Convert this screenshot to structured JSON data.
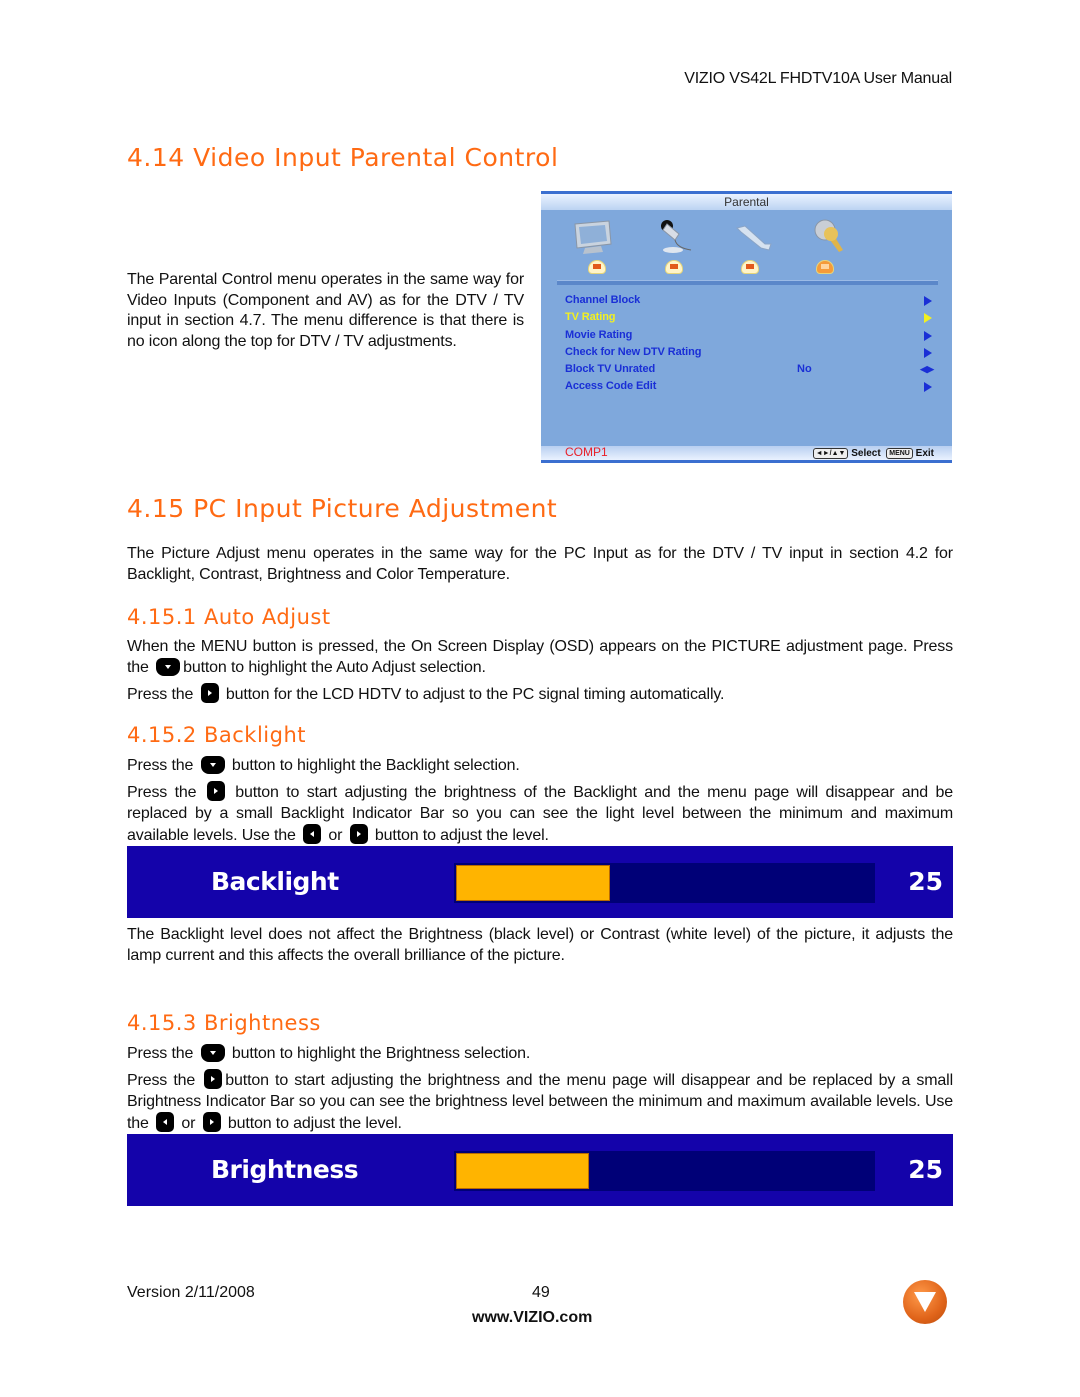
{
  "header": {
    "manual_title": "VIZIO VS42L FHDTV10A User Manual"
  },
  "section_4_14": {
    "heading": "4.14 Video Input Parental Control",
    "body": "The Parental Control menu operates in the same way for Video Inputs (Component and AV) as for the DTV / TV input in section 4.7.  The menu difference is that there is no icon along the top for DTV / TV adjustments.",
    "osd": {
      "title": "Parental",
      "icons": [
        "tv-screen-icon",
        "microphone-icon",
        "wrench-icon",
        "keys-icon"
      ],
      "active_tab_index": 3,
      "items": [
        {
          "label": "Channel Block",
          "value": "",
          "control": "arrow-right",
          "selected": false
        },
        {
          "label": "TV Rating",
          "value": "",
          "control": "arrow-right",
          "selected": true
        },
        {
          "label": "Movie Rating",
          "value": "",
          "control": "arrow-right",
          "selected": false
        },
        {
          "label": "Check for New DTV Rating",
          "value": "",
          "control": "arrow-right",
          "selected": false
        },
        {
          "label": "Block TV Unrated",
          "value": "No",
          "control": "arrow-left-right",
          "selected": false
        },
        {
          "label": "Access Code Edit",
          "value": "",
          "control": "arrow-right",
          "selected": false
        }
      ],
      "input_label": "COMP1",
      "nav_key": "◄►/▲▼",
      "select_label": "Select",
      "menu_key": "MENU",
      "exit_label": "Exit",
      "colors": {
        "item": "#1a2fd6",
        "selected": "#f2f020",
        "input": "#e8202a",
        "background": "#7fa8dc"
      }
    }
  },
  "section_4_15": {
    "heading": "4.15 PC Input Picture Adjustment",
    "body": "The Picture Adjust menu operates in the same way for the PC Input as for the DTV / TV input in section 4.2 for Backlight, Contrast, Brightness and Color Temperature.",
    "auto_adjust": {
      "heading": "4.15.1 Auto Adjust",
      "p1_a": "When the MENU button is pressed, the On Screen Display (OSD) appears on the PICTURE adjustment page.  Press the ",
      "p1_b": "button to highlight the Auto Adjust selection.",
      "p2_a": "Press the ",
      "p2_b": " button for the LCD HDTV to adjust to the PC signal timing automatically."
    },
    "backlight": {
      "heading": "4.15.2 Backlight",
      "p1_a": "Press the ",
      "p1_b": " button to highlight the Backlight selection.",
      "p2_a": "Press the ",
      "p2_b": " button to start adjusting the brightness of the Backlight and the menu page will disappear and be replaced by a small Backlight Indicator Bar so you can see the light level between the minimum and maximum available levels.  Use the ",
      "p2_c": " or ",
      "p2_d": " button to adjust the level.",
      "indicator": {
        "label": "Backlight",
        "value": "25",
        "fill_fraction": 0.37
      },
      "p3": "The Backlight level does not affect the Brightness (black level) or Contrast (white level) of the picture, it adjusts the lamp current and this affects the overall brilliance of the picture."
    },
    "brightness": {
      "heading": "4.15.3 Brightness",
      "p1_a": "Press the ",
      "p1_b": " button to highlight the Brightness selection.",
      "p2_a": "Press the ",
      "p2_b": "button to start adjusting the brightness and the menu page will disappear and be replaced by a small Brightness Indicator Bar so you can see the brightness level between the minimum and maximum available levels.  Use the ",
      "p2_c": " or ",
      "p2_d": " button to adjust the level.",
      "indicator": {
        "label": "Brightness",
        "value": "25",
        "fill_fraction": 0.32
      }
    }
  },
  "footer": {
    "version": "Version 2/11/2008",
    "page_number": "49",
    "url": "www.VIZIO.com",
    "logo": "vizio-v-logo-icon"
  },
  "colors": {
    "heading": "#ff6a13",
    "indicator_bg": "#1403aa",
    "indicator_track": "#000077",
    "indicator_fill": "#ffb400"
  }
}
